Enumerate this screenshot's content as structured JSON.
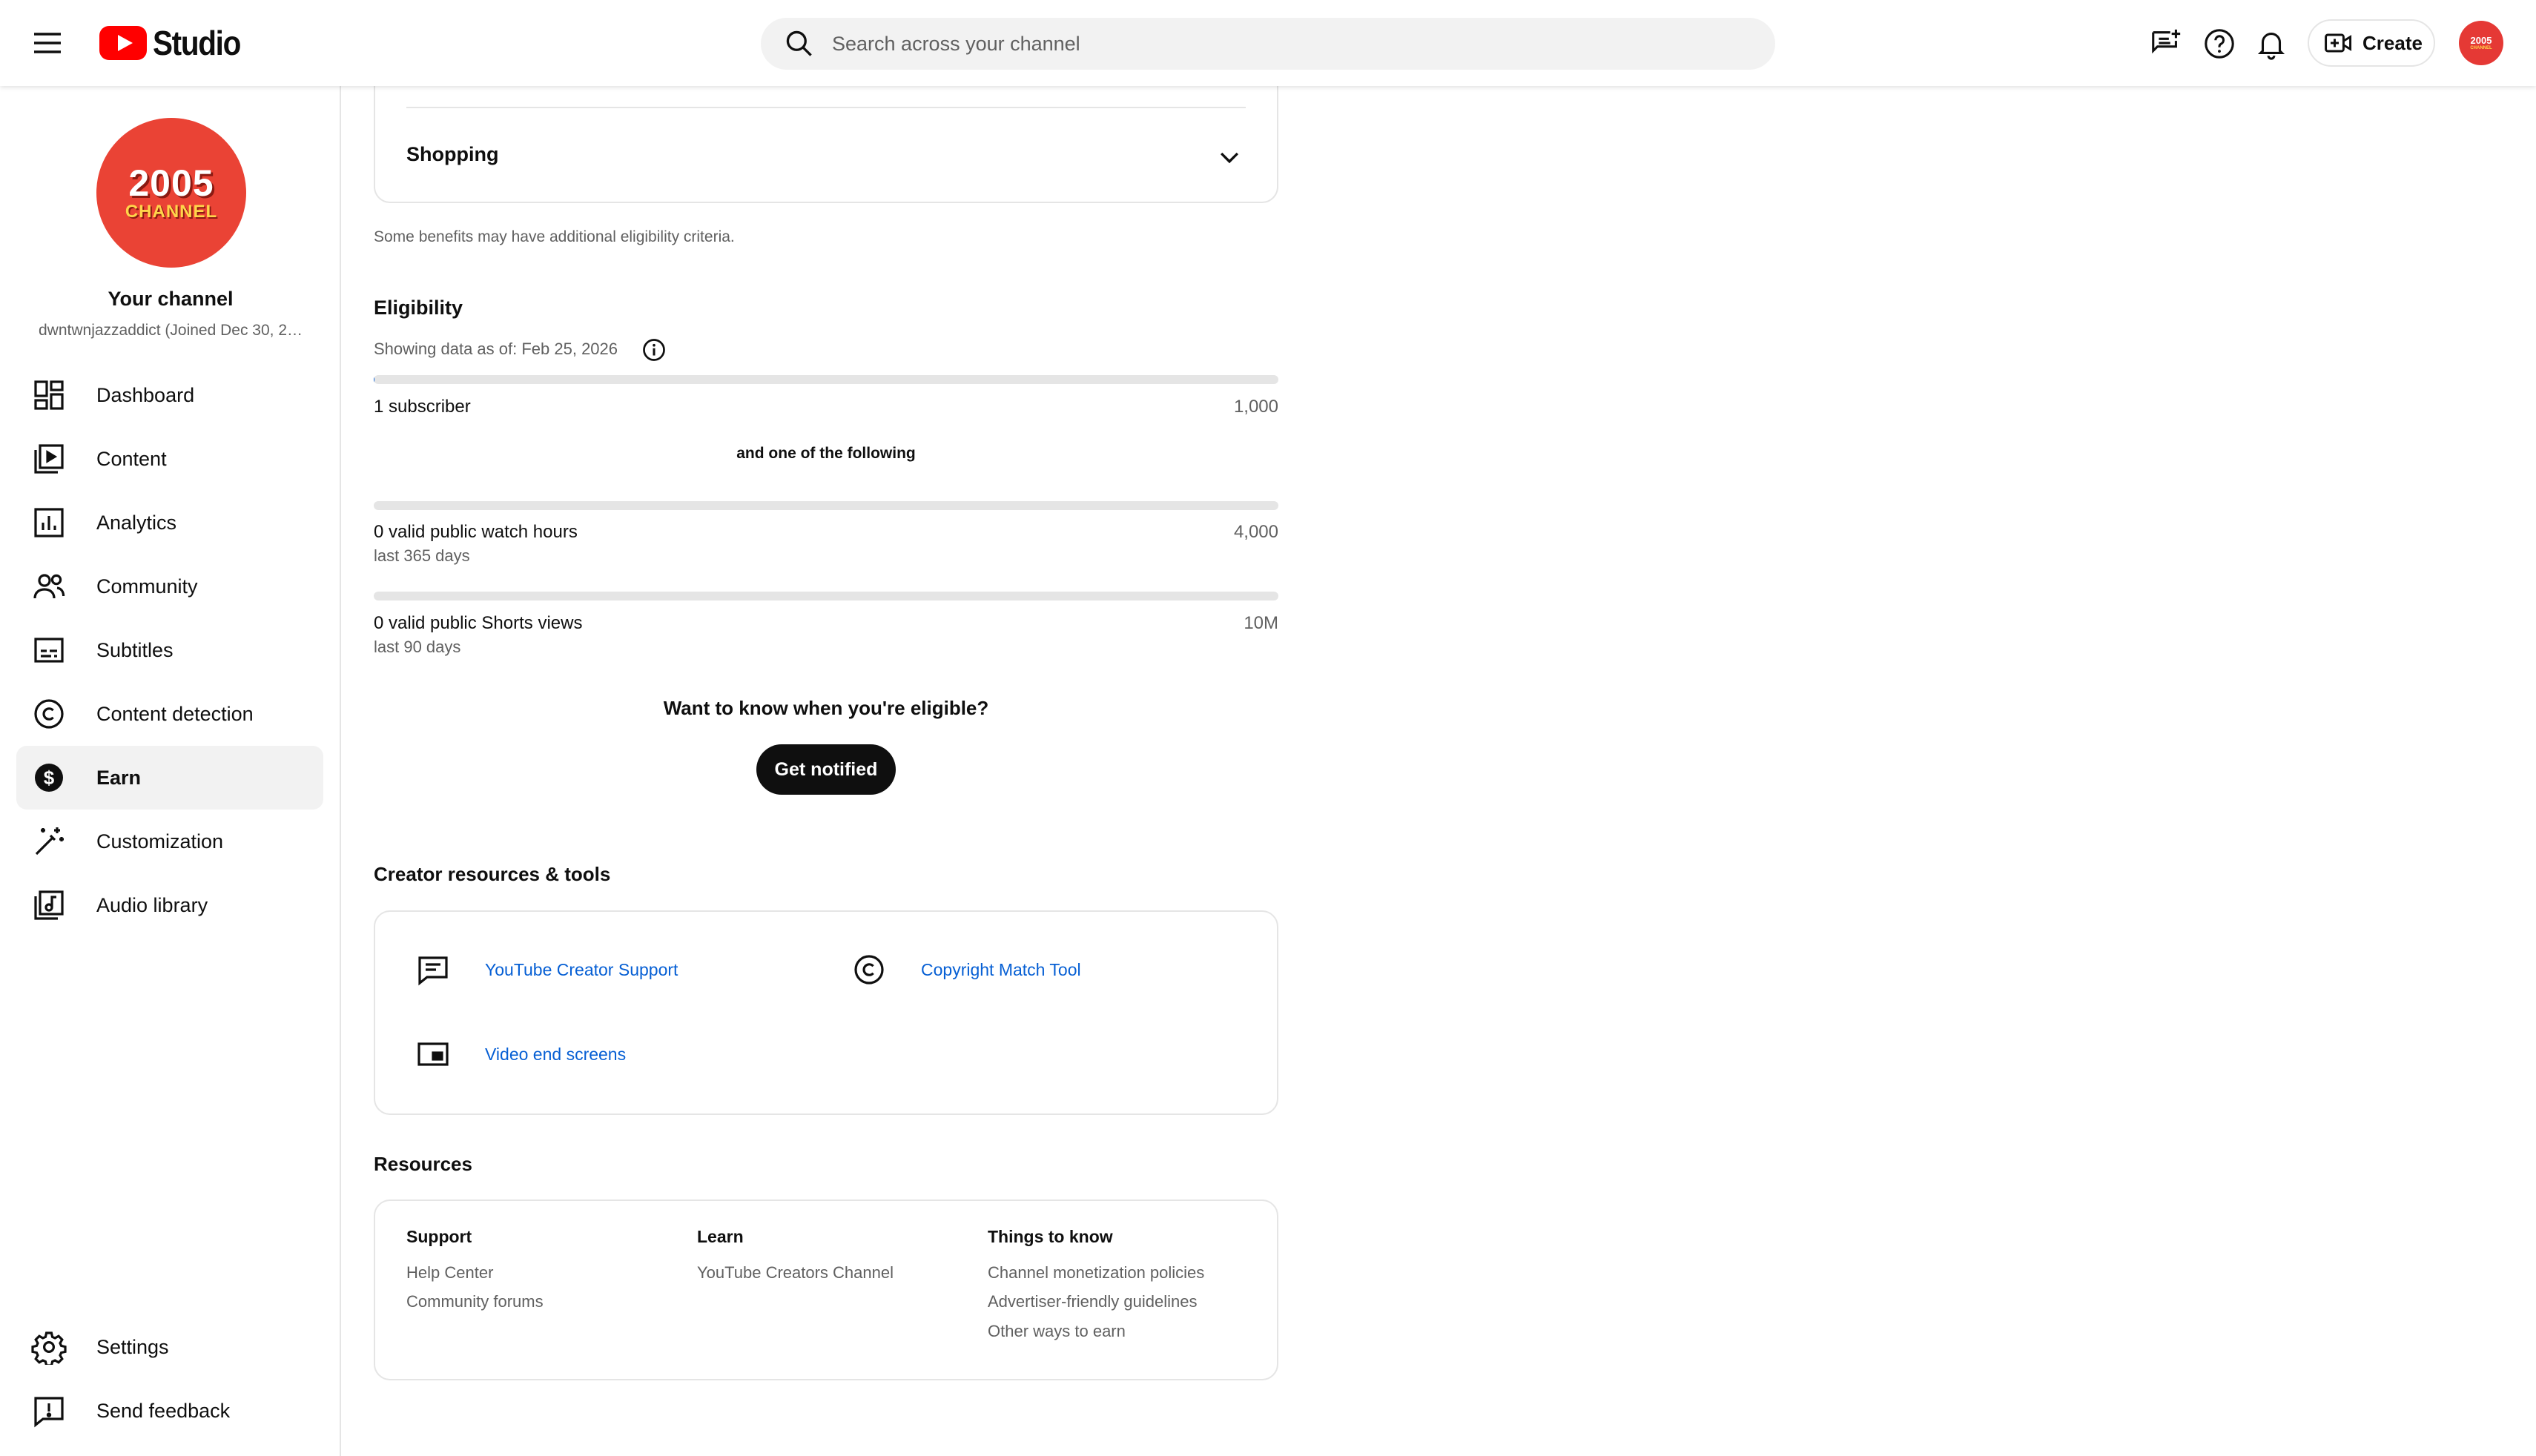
{
  "header": {
    "app_name": "Studio",
    "search_placeholder": "Search across your channel",
    "create_label": "Create",
    "avatar_text_1": "2005",
    "avatar_text_2": "CHANNEL"
  },
  "sidebar": {
    "channel_avatar_big": "2005",
    "channel_avatar_small": "CHANNEL",
    "channel_title": "Your channel",
    "channel_subtitle": "dwntwnjazzaddict (Joined Dec 30, 2…",
    "items": [
      {
        "label": "Dashboard",
        "icon": "dashboard-icon",
        "active": false
      },
      {
        "label": "Content",
        "icon": "content-icon",
        "active": false
      },
      {
        "label": "Analytics",
        "icon": "analytics-icon",
        "active": false
      },
      {
        "label": "Community",
        "icon": "community-icon",
        "active": false
      },
      {
        "label": "Subtitles",
        "icon": "subtitles-icon",
        "active": false
      },
      {
        "label": "Content detection",
        "icon": "copyright-icon",
        "active": false
      },
      {
        "label": "Earn",
        "icon": "dollar-icon",
        "active": true
      },
      {
        "label": "Customization",
        "icon": "magic-wand-icon",
        "active": false
      },
      {
        "label": "Audio library",
        "icon": "audio-library-icon",
        "active": false
      }
    ],
    "bottom_items": [
      {
        "label": "Settings",
        "icon": "gear-icon"
      },
      {
        "label": "Send feedback",
        "icon": "feedback-icon"
      }
    ]
  },
  "benefits": {
    "shopping_label": "Shopping",
    "note": "Some benefits may have additional eligibility criteria."
  },
  "eligibility": {
    "title": "Eligibility",
    "data_as_of": "Showing data as of: Feb 25, 2026",
    "subscribers": {
      "label": "1 subscriber",
      "target": "1,000",
      "progress": 0.001
    },
    "or_text": "and one of the following",
    "watch_hours": {
      "label": "0 valid public watch hours",
      "sub": "last 365 days",
      "target": "4,000",
      "progress": 0
    },
    "shorts_views": {
      "label": "0 valid public Shorts views",
      "sub": "last 90 days",
      "target": "10M",
      "progress": 0
    },
    "question": "Want to know when you're eligible?",
    "notify_button": "Get notified"
  },
  "creator_tools": {
    "title": "Creator resources & tools",
    "items": [
      {
        "label": "YouTube Creator Support",
        "icon": "chat-icon"
      },
      {
        "label": "Copyright Match Tool",
        "icon": "copyright-icon"
      },
      {
        "label": "Video end screens",
        "icon": "end-screen-icon"
      }
    ]
  },
  "resources": {
    "title": "Resources",
    "columns": [
      {
        "heading": "Support",
        "links": [
          "Help Center",
          "Community forums"
        ]
      },
      {
        "heading": "Learn",
        "links": [
          "YouTube Creators Channel"
        ]
      },
      {
        "heading": "Things to know",
        "links": [
          "Channel monetization policies",
          "Advertiser-friendly guidelines",
          "Other ways to earn"
        ]
      }
    ]
  },
  "colors": {
    "brand_red": "#ff0000",
    "link_blue": "#065fd4",
    "avatar_red": "#ea4335"
  }
}
